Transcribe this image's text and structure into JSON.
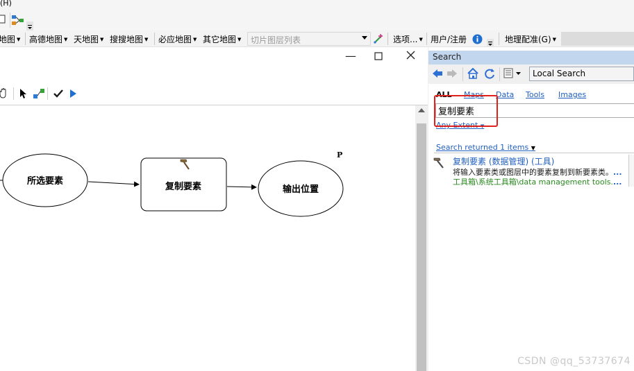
{
  "menu": {
    "partial_item": "(H)"
  },
  "map_toolbar": {
    "items": [
      "地图",
      "高德地图",
      "天地图",
      "搜搜地图",
      "必应地图",
      "其它地图"
    ],
    "tiles_placeholder": "切片图层列表",
    "options_label": "选项...",
    "user_label": "用户/注册",
    "georef_label": "地理配准(G)"
  },
  "model": {
    "nodes": {
      "input": "所选要素",
      "tool": "复制要素",
      "output": "输出位置"
    },
    "param_marker": "P"
  },
  "search": {
    "header": "Search",
    "scope": "Local Search",
    "tabs": [
      "ALL",
      "Maps",
      "Data",
      "Tools",
      "Images"
    ],
    "query": "复制要素",
    "extent": "Any Extent",
    "results_count": "Search returned 1 items",
    "result": {
      "title": "复制要素 (数据管理) (工具)",
      "description": "将输入要素类或图层中的要素复制到新要素类。",
      "path": "工具箱\\系统工具箱\\data management tools."
    }
  },
  "watermark": "CSDN @qq_53737674",
  "colors": {
    "accent_blue": "#1f5fbf",
    "highlight_red": "#e0201d",
    "path_green": "#2a8a1f"
  }
}
